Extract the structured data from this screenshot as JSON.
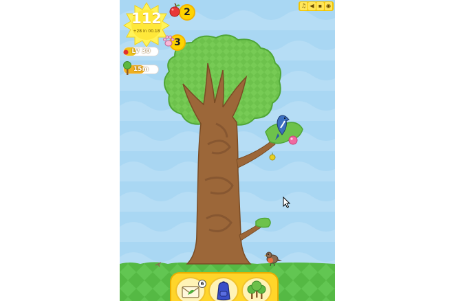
{
  "hud": {
    "sun_score": "112",
    "sun_rate": "+28 in 00.18",
    "apples": "2",
    "paws": "3",
    "level": "LV 30",
    "level_progress": 0.35,
    "tree_height": "15m",
    "height_progress": 0.6
  },
  "toolbar": {
    "buttons": [
      {
        "icon": "music-icon",
        "glyph": "♫"
      },
      {
        "icon": "sound-icon",
        "glyph": "◀"
      },
      {
        "icon": "save-icon",
        "glyph": "▪"
      },
      {
        "icon": "eye-icon",
        "glyph": "◉"
      }
    ]
  },
  "tray": {
    "mail_count": "6",
    "buttons": [
      {
        "icon": "mail-leaf-icon"
      },
      {
        "icon": "backpack-icon"
      },
      {
        "icon": "forest-icon"
      }
    ]
  },
  "colors": {
    "sky": "#a9d6f2",
    "grass": "#5cbf4a",
    "trunk": "#9b6638",
    "canopy": "#6cc04a",
    "accent": "#ffd400"
  }
}
